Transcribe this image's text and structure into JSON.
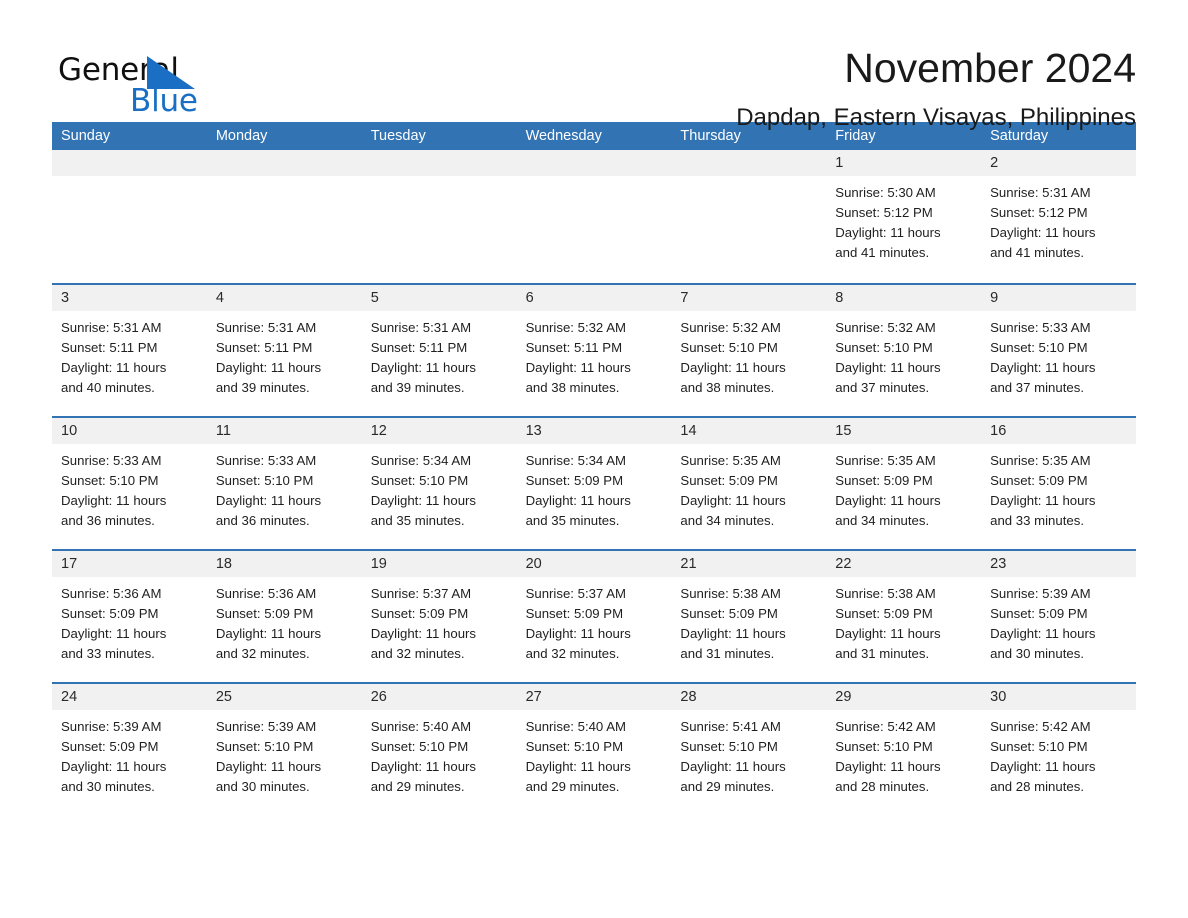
{
  "logo": {
    "text_top": "General",
    "text_bottom": "Blue",
    "triangle_color": "#1a6fc4",
    "top_color": "#101010",
    "bottom_color": "#1a6fc4"
  },
  "header": {
    "month_title": "November 2024",
    "location": "Dapdap, Eastern Visayas, Philippines"
  },
  "theme": {
    "header_blue": "#3173b3",
    "daynum_band": "#f1f1f1",
    "text": "#1a1a1a"
  },
  "weekdays": [
    "Sunday",
    "Monday",
    "Tuesday",
    "Wednesday",
    "Thursday",
    "Friday",
    "Saturday"
  ],
  "weeks": [
    [
      {
        "day": "",
        "empty": true
      },
      {
        "day": "",
        "empty": true
      },
      {
        "day": "",
        "empty": true
      },
      {
        "day": "",
        "empty": true
      },
      {
        "day": "",
        "empty": true
      },
      {
        "day": "1",
        "sunrise": "Sunrise: 5:30 AM",
        "sunset": "Sunset: 5:12 PM",
        "daylight1": "Daylight: 11 hours",
        "daylight2": "and 41 minutes."
      },
      {
        "day": "2",
        "sunrise": "Sunrise: 5:31 AM",
        "sunset": "Sunset: 5:12 PM",
        "daylight1": "Daylight: 11 hours",
        "daylight2": "and 41 minutes."
      }
    ],
    [
      {
        "day": "3",
        "sunrise": "Sunrise: 5:31 AM",
        "sunset": "Sunset: 5:11 PM",
        "daylight1": "Daylight: 11 hours",
        "daylight2": "and 40 minutes."
      },
      {
        "day": "4",
        "sunrise": "Sunrise: 5:31 AM",
        "sunset": "Sunset: 5:11 PM",
        "daylight1": "Daylight: 11 hours",
        "daylight2": "and 39 minutes."
      },
      {
        "day": "5",
        "sunrise": "Sunrise: 5:31 AM",
        "sunset": "Sunset: 5:11 PM",
        "daylight1": "Daylight: 11 hours",
        "daylight2": "and 39 minutes."
      },
      {
        "day": "6",
        "sunrise": "Sunrise: 5:32 AM",
        "sunset": "Sunset: 5:11 PM",
        "daylight1": "Daylight: 11 hours",
        "daylight2": "and 38 minutes."
      },
      {
        "day": "7",
        "sunrise": "Sunrise: 5:32 AM",
        "sunset": "Sunset: 5:10 PM",
        "daylight1": "Daylight: 11 hours",
        "daylight2": "and 38 minutes."
      },
      {
        "day": "8",
        "sunrise": "Sunrise: 5:32 AM",
        "sunset": "Sunset: 5:10 PM",
        "daylight1": "Daylight: 11 hours",
        "daylight2": "and 37 minutes."
      },
      {
        "day": "9",
        "sunrise": "Sunrise: 5:33 AM",
        "sunset": "Sunset: 5:10 PM",
        "daylight1": "Daylight: 11 hours",
        "daylight2": "and 37 minutes."
      }
    ],
    [
      {
        "day": "10",
        "sunrise": "Sunrise: 5:33 AM",
        "sunset": "Sunset: 5:10 PM",
        "daylight1": "Daylight: 11 hours",
        "daylight2": "and 36 minutes."
      },
      {
        "day": "11",
        "sunrise": "Sunrise: 5:33 AM",
        "sunset": "Sunset: 5:10 PM",
        "daylight1": "Daylight: 11 hours",
        "daylight2": "and 36 minutes."
      },
      {
        "day": "12",
        "sunrise": "Sunrise: 5:34 AM",
        "sunset": "Sunset: 5:10 PM",
        "daylight1": "Daylight: 11 hours",
        "daylight2": "and 35 minutes."
      },
      {
        "day": "13",
        "sunrise": "Sunrise: 5:34 AM",
        "sunset": "Sunset: 5:09 PM",
        "daylight1": "Daylight: 11 hours",
        "daylight2": "and 35 minutes."
      },
      {
        "day": "14",
        "sunrise": "Sunrise: 5:35 AM",
        "sunset": "Sunset: 5:09 PM",
        "daylight1": "Daylight: 11 hours",
        "daylight2": "and 34 minutes."
      },
      {
        "day": "15",
        "sunrise": "Sunrise: 5:35 AM",
        "sunset": "Sunset: 5:09 PM",
        "daylight1": "Daylight: 11 hours",
        "daylight2": "and 34 minutes."
      },
      {
        "day": "16",
        "sunrise": "Sunrise: 5:35 AM",
        "sunset": "Sunset: 5:09 PM",
        "daylight1": "Daylight: 11 hours",
        "daylight2": "and 33 minutes."
      }
    ],
    [
      {
        "day": "17",
        "sunrise": "Sunrise: 5:36 AM",
        "sunset": "Sunset: 5:09 PM",
        "daylight1": "Daylight: 11 hours",
        "daylight2": "and 33 minutes."
      },
      {
        "day": "18",
        "sunrise": "Sunrise: 5:36 AM",
        "sunset": "Sunset: 5:09 PM",
        "daylight1": "Daylight: 11 hours",
        "daylight2": "and 32 minutes."
      },
      {
        "day": "19",
        "sunrise": "Sunrise: 5:37 AM",
        "sunset": "Sunset: 5:09 PM",
        "daylight1": "Daylight: 11 hours",
        "daylight2": "and 32 minutes."
      },
      {
        "day": "20",
        "sunrise": "Sunrise: 5:37 AM",
        "sunset": "Sunset: 5:09 PM",
        "daylight1": "Daylight: 11 hours",
        "daylight2": "and 32 minutes."
      },
      {
        "day": "21",
        "sunrise": "Sunrise: 5:38 AM",
        "sunset": "Sunset: 5:09 PM",
        "daylight1": "Daylight: 11 hours",
        "daylight2": "and 31 minutes."
      },
      {
        "day": "22",
        "sunrise": "Sunrise: 5:38 AM",
        "sunset": "Sunset: 5:09 PM",
        "daylight1": "Daylight: 11 hours",
        "daylight2": "and 31 minutes."
      },
      {
        "day": "23",
        "sunrise": "Sunrise: 5:39 AM",
        "sunset": "Sunset: 5:09 PM",
        "daylight1": "Daylight: 11 hours",
        "daylight2": "and 30 minutes."
      }
    ],
    [
      {
        "day": "24",
        "sunrise": "Sunrise: 5:39 AM",
        "sunset": "Sunset: 5:09 PM",
        "daylight1": "Daylight: 11 hours",
        "daylight2": "and 30 minutes."
      },
      {
        "day": "25",
        "sunrise": "Sunrise: 5:39 AM",
        "sunset": "Sunset: 5:10 PM",
        "daylight1": "Daylight: 11 hours",
        "daylight2": "and 30 minutes."
      },
      {
        "day": "26",
        "sunrise": "Sunrise: 5:40 AM",
        "sunset": "Sunset: 5:10 PM",
        "daylight1": "Daylight: 11 hours",
        "daylight2": "and 29 minutes."
      },
      {
        "day": "27",
        "sunrise": "Sunrise: 5:40 AM",
        "sunset": "Sunset: 5:10 PM",
        "daylight1": "Daylight: 11 hours",
        "daylight2": "and 29 minutes."
      },
      {
        "day": "28",
        "sunrise": "Sunrise: 5:41 AM",
        "sunset": "Sunset: 5:10 PM",
        "daylight1": "Daylight: 11 hours",
        "daylight2": "and 29 minutes."
      },
      {
        "day": "29",
        "sunrise": "Sunrise: 5:42 AM",
        "sunset": "Sunset: 5:10 PM",
        "daylight1": "Daylight: 11 hours",
        "daylight2": "and 28 minutes."
      },
      {
        "day": "30",
        "sunrise": "Sunrise: 5:42 AM",
        "sunset": "Sunset: 5:10 PM",
        "daylight1": "Daylight: 11 hours",
        "daylight2": "and 28 minutes."
      }
    ]
  ]
}
